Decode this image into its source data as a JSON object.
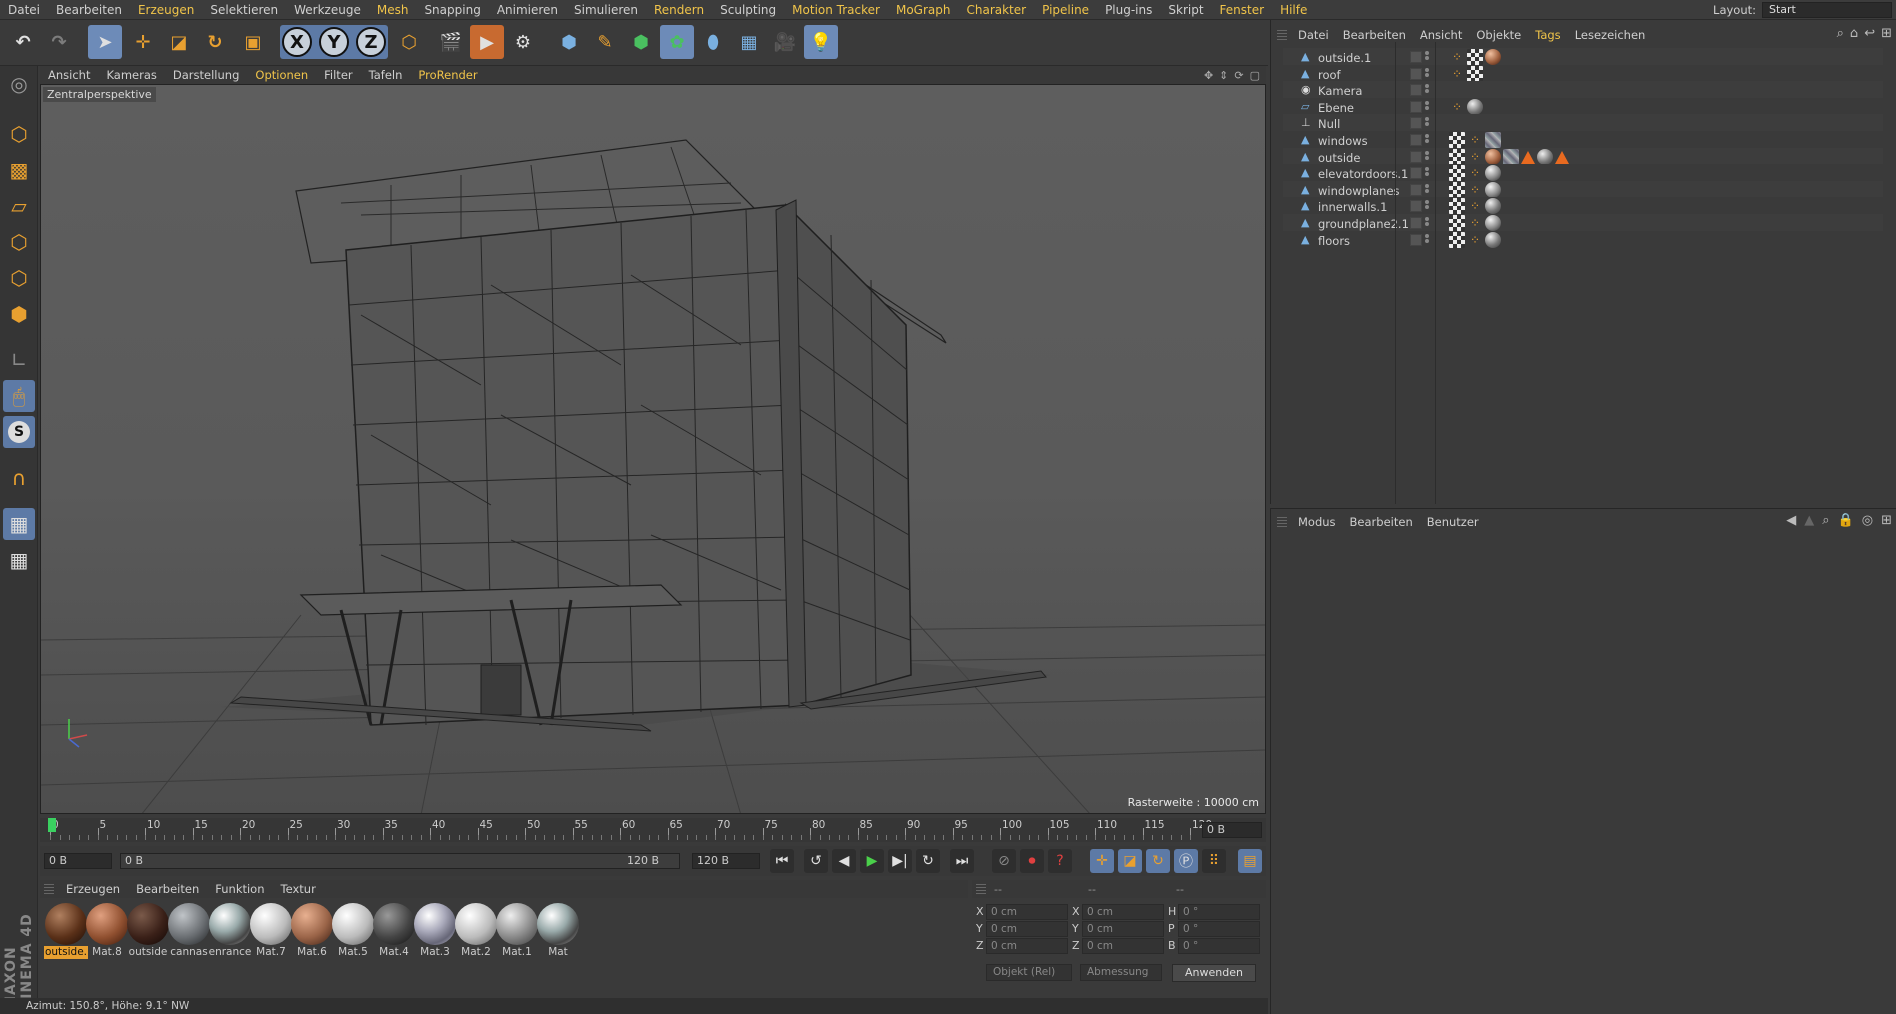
{
  "menubar": {
    "items": [
      {
        "label": "Datei",
        "highlight": false
      },
      {
        "label": "Bearbeiten",
        "highlight": false
      },
      {
        "label": "Erzeugen",
        "highlight": true
      },
      {
        "label": "Selektieren",
        "highlight": false
      },
      {
        "label": "Werkzeuge",
        "highlight": false
      },
      {
        "label": "Mesh",
        "highlight": true
      },
      {
        "label": "Snapping",
        "highlight": false
      },
      {
        "label": "Animieren",
        "highlight": false
      },
      {
        "label": "Simulieren",
        "highlight": false
      },
      {
        "label": "Rendern",
        "highlight": true
      },
      {
        "label": "Sculpting",
        "highlight": false
      },
      {
        "label": "Motion Tracker",
        "highlight": true
      },
      {
        "label": "MoGraph",
        "highlight": true
      },
      {
        "label": "Charakter",
        "highlight": true
      },
      {
        "label": "Pipeline",
        "highlight": true
      },
      {
        "label": "Plug-ins",
        "highlight": false
      },
      {
        "label": "Skript",
        "highlight": false
      },
      {
        "label": "Fenster",
        "highlight": true
      },
      {
        "label": "Hilfe",
        "highlight": true
      }
    ],
    "layout_label": "Layout:",
    "layout_value": "Start"
  },
  "toolbar": {
    "axis_x": "X",
    "axis_y": "Y",
    "axis_z": "Z"
  },
  "viewport": {
    "menu": [
      {
        "label": "Ansicht",
        "highlight": false
      },
      {
        "label": "Kameras",
        "highlight": false
      },
      {
        "label": "Darstellung",
        "highlight": false
      },
      {
        "label": "Optionen",
        "highlight": true
      },
      {
        "label": "Filter",
        "highlight": false
      },
      {
        "label": "Tafeln",
        "highlight": false
      },
      {
        "label": "ProRender",
        "highlight": true
      }
    ],
    "camera_label": "Zentralperspektive",
    "raster_text": "Rasterweite : 10000 cm"
  },
  "timeline": {
    "ticks": [
      "0",
      "5",
      "10",
      "15",
      "20",
      "25",
      "30",
      "35",
      "40",
      "45",
      "50",
      "55",
      "60",
      "65",
      "70",
      "75",
      "80",
      "85",
      "90",
      "95",
      "100",
      "105",
      "110",
      "115",
      "120"
    ],
    "current_frame_field": "0 B"
  },
  "transport": {
    "start_field": "0 B",
    "range_start": "0 B",
    "range_end": "120 B",
    "end_field": "120 B"
  },
  "materials": {
    "menu": [
      "Erzeugen",
      "Bearbeiten",
      "Funktion",
      "Textur"
    ],
    "items": [
      {
        "label": "outside.",
        "style": "brown",
        "selected": true
      },
      {
        "label": "Mat.8",
        "style": "brick",
        "selected": false
      },
      {
        "label": "outside",
        "style": "dark",
        "selected": false
      },
      {
        "label": "cannas",
        "style": "grey",
        "selected": false
      },
      {
        "label": "enrance",
        "style": "chrome",
        "selected": false
      },
      {
        "label": "Mat.7",
        "style": "white",
        "selected": false
      },
      {
        "label": "Mat.6",
        "style": "copper",
        "selected": false
      },
      {
        "label": "Mat.5",
        "style": "white",
        "selected": false
      },
      {
        "label": "Mat.4",
        "style": "darkgrey",
        "selected": false
      },
      {
        "label": "Mat.3",
        "style": "glass",
        "selected": false
      },
      {
        "label": "Mat.2",
        "style": "white",
        "selected": false
      },
      {
        "label": "Mat.1",
        "style": "midgrey",
        "selected": false
      },
      {
        "label": "Mat",
        "style": "chrome",
        "selected": false
      }
    ]
  },
  "coords": {
    "headers": [
      "--",
      "--",
      "--"
    ],
    "rows": [
      {
        "l1": "X",
        "v1": "0 cm",
        "l2": "X",
        "v2": "0 cm",
        "l3": "H",
        "v3": "0 °"
      },
      {
        "l1": "Y",
        "v1": "0 cm",
        "l2": "Y",
        "v2": "0 cm",
        "l3": "P",
        "v3": "0 °"
      },
      {
        "l1": "Z",
        "v1": "0 cm",
        "l2": "Z",
        "v2": "0 cm",
        "l3": "B",
        "v3": "0 °"
      }
    ],
    "mode_dropdown": "Objekt (Rel)",
    "size_dropdown": "Abmessung",
    "apply_label": "Anwenden"
  },
  "status_text": "Azimut: 150.8°, Höhe: 9.1°  NW",
  "brand": "MAXON CINEMA 4D",
  "objects": {
    "menu": [
      {
        "label": "Datei",
        "highlight": false
      },
      {
        "label": "Bearbeiten",
        "highlight": false
      },
      {
        "label": "Ansicht",
        "highlight": false
      },
      {
        "label": "Objekte",
        "highlight": false
      },
      {
        "label": "Tags",
        "highlight": true
      },
      {
        "label": "Lesezeichen",
        "highlight": false
      }
    ],
    "rows": [
      {
        "name": "outside.1",
        "icon": "polygon-icon",
        "tags": [
          "org",
          "chk",
          "cop"
        ]
      },
      {
        "name": "roof",
        "icon": "polygon-icon",
        "tags": [
          "org",
          "chk"
        ]
      },
      {
        "name": "Kamera",
        "icon": "camera-icon",
        "tags": []
      },
      {
        "name": "Ebene",
        "icon": "plane-icon",
        "tags": [
          "org",
          "grey"
        ]
      },
      {
        "name": "Null",
        "icon": "null-icon",
        "tags": []
      },
      {
        "name": "windows",
        "icon": "polygon-icon",
        "tags": [
          "chk",
          "org",
          "glass"
        ]
      },
      {
        "name": "outside",
        "icon": "polygon-icon",
        "tags": [
          "chk",
          "org",
          "cop",
          "glass",
          "tri",
          "grey",
          "tri"
        ]
      },
      {
        "name": "elevatordoors.1",
        "icon": "polygon-icon",
        "tags": [
          "chk",
          "org",
          "sph"
        ]
      },
      {
        "name": "windowplanes",
        "icon": "polygon-icon",
        "tags": [
          "chk",
          "org",
          "sph"
        ]
      },
      {
        "name": "innerwalls.1",
        "icon": "polygon-icon",
        "tags": [
          "chk",
          "org",
          "grey"
        ]
      },
      {
        "name": "groundplane2.1",
        "icon": "polygon-icon",
        "tags": [
          "chk",
          "org",
          "sph"
        ]
      },
      {
        "name": "floors",
        "icon": "polygon-icon",
        "tags": [
          "chk",
          "org",
          "grey"
        ]
      }
    ]
  },
  "attributes": {
    "menu": [
      "Modus",
      "Bearbeiten",
      "Benutzer"
    ]
  }
}
